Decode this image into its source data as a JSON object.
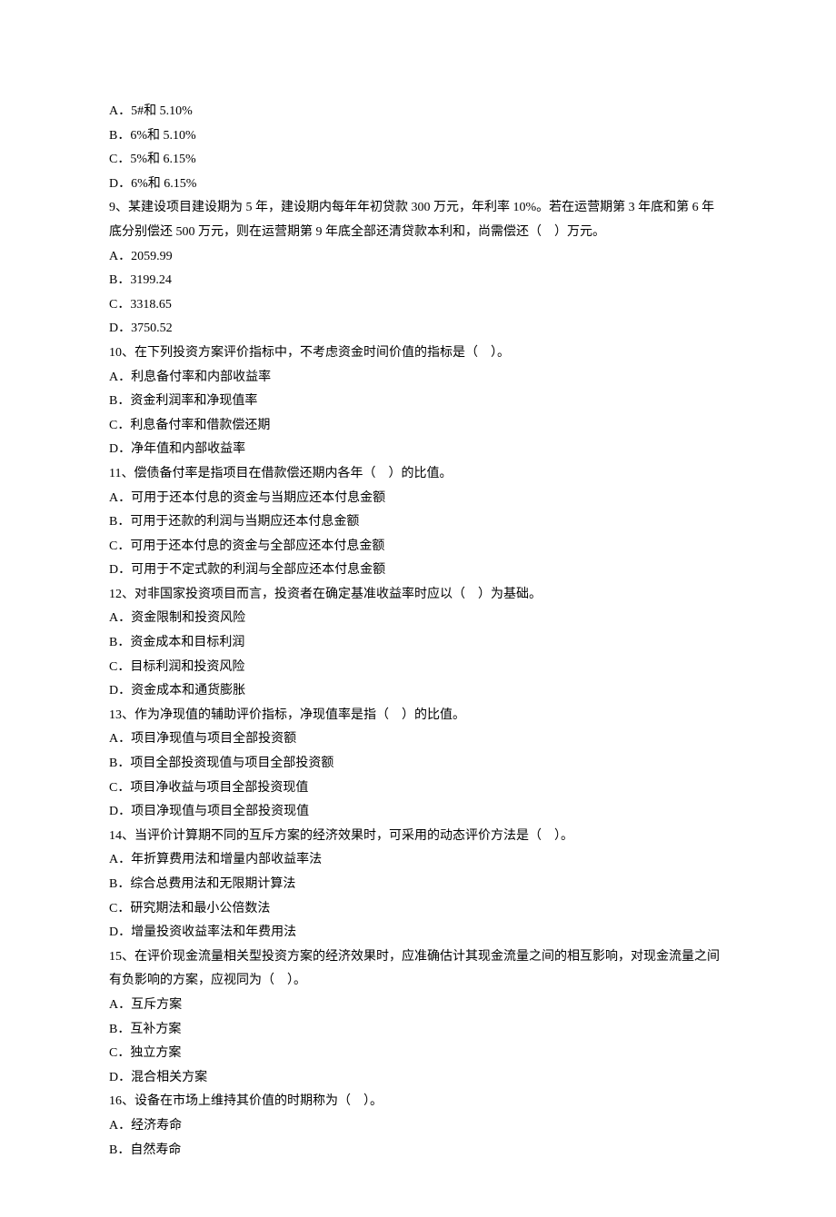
{
  "lines": [
    "A．5#和 5.10%",
    "B．6%和 5.10%",
    "C．5%和 6.15%",
    "D．6%和 6.15%",
    "9、某建设项目建设期为 5 年，建设期内每年年初贷款 300 万元，年利率 10%。若在运营期第 3 年底和第 6 年底分别偿还 500 万元，则在运营期第 9 年底全部还清贷款本利和，尚需偿还（　）万元。",
    "A．2059.99",
    "B．3199.24",
    "C．3318.65",
    "D．3750.52",
    "10、在下列投资方案评价指标中，不考虑资金时间价值的指标是（　）。",
    "A．利息备付率和内部收益率",
    "B．资金利润率和净现值率",
    "C．利息备付率和借款偿还期",
    "D．净年值和内部收益率",
    "11、偿债备付率是指项目在借款偿还期内各年（　）的比值。",
    "A．可用于还本付息的资金与当期应还本付息金额",
    "B．可用于还款的利润与当期应还本付息金额",
    "C．可用于还本付息的资金与全部应还本付息金额",
    "D．可用于不定式款的利润与全部应还本付息金额",
    "12、对非国家投资项目而言，投资者在确定基准收益率时应以（　）为基础。",
    "A．资金限制和投资风险",
    "B．资金成本和目标利润",
    "C．目标利润和投资风险",
    "D．资金成本和通货膨胀",
    "13、作为净现值的辅助评价指标，净现值率是指（　）的比值。",
    "A．项目净现值与项目全部投资额",
    "B．项目全部投资现值与项目全部投资额",
    "C．项目净收益与项目全部投资现值",
    "D．项目净现值与项目全部投资现值",
    "14、当评价计算期不同的互斥方案的经济效果时，可采用的动态评价方法是（　）。",
    "A．年折算费用法和增量内部收益率法",
    "B．综合总费用法和无限期计算法",
    "C．研究期法和最小公倍数法",
    "D．增量投资收益率法和年费用法",
    "15、在评价现金流量相关型投资方案的经济效果时，应准确估计其现金流量之间的相互影响，对现金流量之间有负影响的方案，应视同为（　）。",
    "A．互斥方案",
    "B．互补方案",
    "C．独立方案",
    "D．混合相关方案",
    "16、设备在市场上维持其价值的时期称为（　）。",
    "A．经济寿命",
    "B．自然寿命"
  ]
}
